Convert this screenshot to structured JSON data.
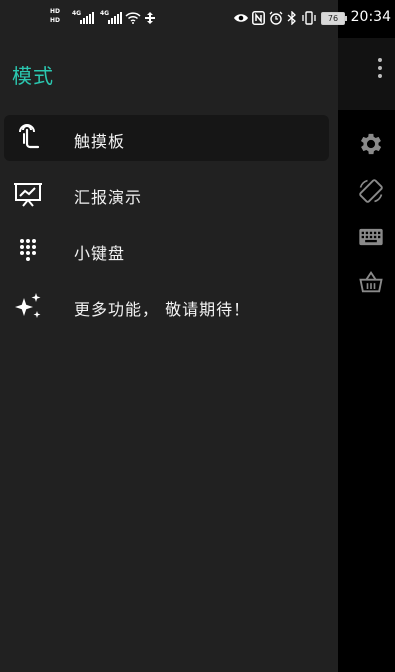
{
  "status_bar": {
    "left_icons": [
      "hd-icon",
      "signal-4g-icon",
      "hd-icon",
      "signal-4g-icon",
      "wifi-icon",
      "data-transfer-icon"
    ],
    "network_label_1": "4G",
    "network_label_2": "4G",
    "hd_label": "HD",
    "battery_level": "76",
    "time": "20:34",
    "right_icons": [
      "eye-icon",
      "nfc-icon",
      "alarm-icon",
      "bluetooth-icon",
      "vibrate-icon",
      "battery-icon"
    ]
  },
  "drawer": {
    "title": "模式",
    "items": [
      {
        "label": "触摸板",
        "icon": "touch-icon",
        "selected": true
      },
      {
        "label": "汇报演示",
        "icon": "presentation-icon",
        "selected": false
      },
      {
        "label": "小键盘",
        "icon": "keypad-icon",
        "selected": false
      },
      {
        "label": "更多功能， 敬请期待！",
        "icon": "sparkle-icon",
        "selected": false
      }
    ]
  },
  "side_actions": [
    "gear-icon",
    "rotate-screen-icon",
    "keyboard-icon",
    "basket-icon"
  ],
  "colors": {
    "accent": "#2bc7b0",
    "drawer_bg": "#212121",
    "selected_bg": "#161616"
  }
}
